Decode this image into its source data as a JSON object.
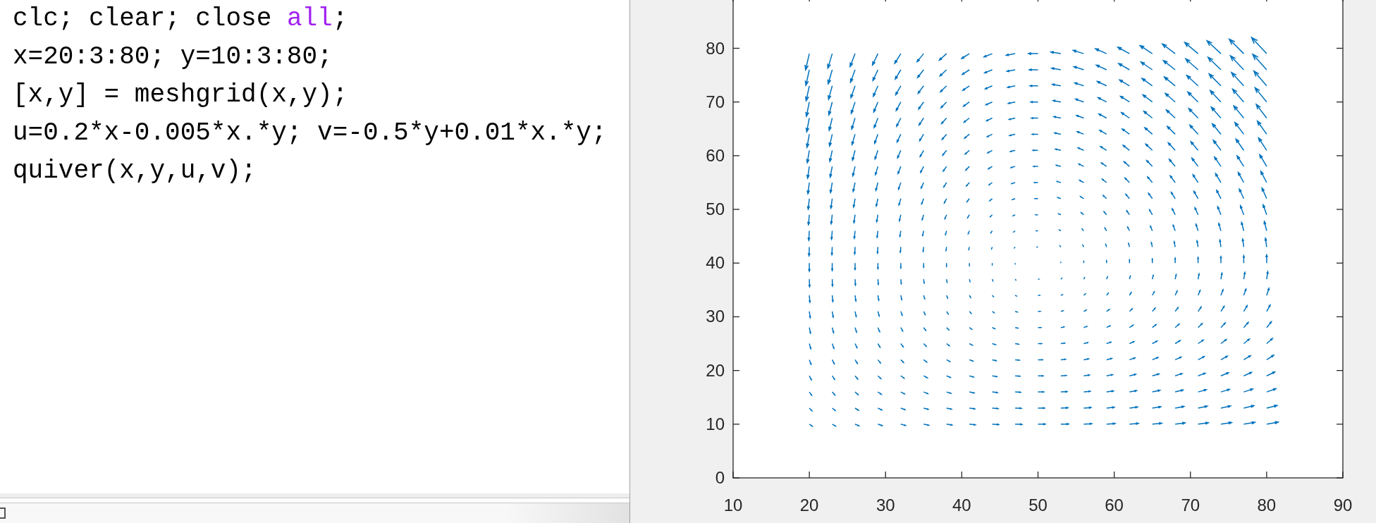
{
  "editor": {
    "lines": [
      [
        {
          "text": "clc; clear; close ",
          "kind": "plain"
        },
        {
          "text": "all",
          "kind": "keyword"
        },
        {
          "text": ";",
          "kind": "plain"
        }
      ],
      [
        {
          "text": "x=20:3:80; y=10:3:80;",
          "kind": "plain"
        }
      ],
      [
        {
          "text": "[x,y] = meshgrid(x,y);",
          "kind": "plain"
        }
      ],
      [
        {
          "text": "u=0.2*x-0.005*x.*y; v=-0.5*y+0.01*x.*y;",
          "kind": "plain"
        }
      ],
      [
        {
          "text": "quiver(x,y,u,v);",
          "kind": "plain"
        }
      ]
    ]
  },
  "figure": {
    "xticks": [
      "10",
      "20",
      "30",
      "40",
      "50",
      "60",
      "70",
      "80",
      "90"
    ],
    "yticks": [
      "80",
      "70",
      "60",
      "50",
      "40",
      "30",
      "20",
      "10",
      "0"
    ]
  }
}
